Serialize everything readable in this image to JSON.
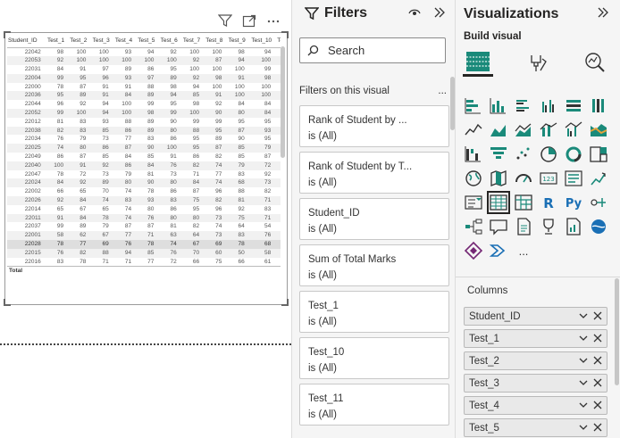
{
  "table": {
    "columns": [
      "Student_ID",
      "Test_1",
      "Test_2",
      "Test_3",
      "Test_4",
      "Test_5",
      "Test_6",
      "Test_7",
      "Test_8",
      "Test_9",
      "Test_10",
      "Te"
    ],
    "rows": [
      [
        "22042",
        "98",
        "100",
        "100",
        "93",
        "94",
        "92",
        "100",
        "100",
        "98",
        "94"
      ],
      [
        "22053",
        "92",
        "100",
        "100",
        "100",
        "100",
        "100",
        "92",
        "87",
        "94",
        "100"
      ],
      [
        "22031",
        "84",
        "91",
        "97",
        "89",
        "86",
        "95",
        "100",
        "100",
        "100",
        "99"
      ],
      [
        "22004",
        "99",
        "95",
        "96",
        "93",
        "97",
        "89",
        "92",
        "98",
        "91",
        "98"
      ],
      [
        "22000",
        "78",
        "87",
        "91",
        "91",
        "88",
        "98",
        "94",
        "100",
        "100",
        "100"
      ],
      [
        "22036",
        "95",
        "89",
        "91",
        "84",
        "89",
        "94",
        "85",
        "91",
        "100",
        "100"
      ],
      [
        "22044",
        "96",
        "92",
        "94",
        "100",
        "99",
        "95",
        "98",
        "92",
        "84",
        "84"
      ],
      [
        "22052",
        "99",
        "100",
        "94",
        "100",
        "98",
        "99",
        "100",
        "90",
        "80",
        "84"
      ],
      [
        "22012",
        "81",
        "83",
        "93",
        "88",
        "89",
        "90",
        "99",
        "99",
        "95",
        "95"
      ],
      [
        "22038",
        "82",
        "83",
        "85",
        "86",
        "89",
        "80",
        "88",
        "95",
        "87",
        "93"
      ],
      [
        "22034",
        "76",
        "79",
        "73",
        "77",
        "83",
        "86",
        "95",
        "89",
        "90",
        "95"
      ],
      [
        "22025",
        "74",
        "80",
        "86",
        "87",
        "90",
        "100",
        "95",
        "87",
        "85",
        "79"
      ],
      [
        "22049",
        "86",
        "87",
        "85",
        "84",
        "85",
        "91",
        "86",
        "82",
        "85",
        "87"
      ],
      [
        "22040",
        "100",
        "91",
        "92",
        "86",
        "84",
        "76",
        "82",
        "74",
        "79",
        "72"
      ],
      [
        "22047",
        "78",
        "72",
        "73",
        "79",
        "81",
        "73",
        "71",
        "77",
        "83",
        "92"
      ],
      [
        "22024",
        "84",
        "92",
        "89",
        "80",
        "90",
        "80",
        "84",
        "74",
        "68",
        "73"
      ],
      [
        "22002",
        "66",
        "65",
        "70",
        "74",
        "78",
        "86",
        "87",
        "96",
        "88",
        "82"
      ],
      [
        "22026",
        "92",
        "84",
        "74",
        "83",
        "93",
        "83",
        "75",
        "82",
        "81",
        "71"
      ],
      [
        "22014",
        "65",
        "67",
        "65",
        "74",
        "80",
        "86",
        "95",
        "96",
        "92",
        "83"
      ],
      [
        "22011",
        "91",
        "84",
        "78",
        "74",
        "76",
        "80",
        "80",
        "73",
        "75",
        "71"
      ],
      [
        "22037",
        "99",
        "89",
        "79",
        "87",
        "87",
        "81",
        "82",
        "74",
        "64",
        "54"
      ],
      [
        "22001",
        "58",
        "62",
        "67",
        "77",
        "71",
        "63",
        "64",
        "73",
        "83",
        "76"
      ],
      [
        "22028",
        "78",
        "77",
        "69",
        "76",
        "78",
        "74",
        "67",
        "69",
        "78",
        "68"
      ],
      [
        "22015",
        "76",
        "82",
        "88",
        "94",
        "85",
        "76",
        "70",
        "60",
        "50",
        "58"
      ],
      [
        "22016",
        "83",
        "78",
        "71",
        "71",
        "77",
        "72",
        "66",
        "75",
        "66",
        "61"
      ]
    ],
    "selected_row": 22,
    "total_label": "Total"
  },
  "filters": {
    "title": "Filters",
    "search_placeholder": "Search",
    "section_label": "Filters on this visual",
    "more": "...",
    "cards": [
      {
        "name": "Rank of Student by ...",
        "value": "is (All)"
      },
      {
        "name": "Rank of Student by T...",
        "value": "is (All)"
      },
      {
        "name": "Student_ID",
        "value": "is (All)"
      },
      {
        "name": "Sum of Total Marks",
        "value": "is (All)"
      },
      {
        "name": "Test_1",
        "value": "is (All)"
      },
      {
        "name": "Test_10",
        "value": "is (All)"
      },
      {
        "name": "Test_11",
        "value": "is (All)"
      }
    ]
  },
  "visualizations": {
    "title": "Visualizations",
    "build_label": "Build visual",
    "more": "...",
    "columns_label": "Columns",
    "fields": [
      "Student_ID",
      "Test_1",
      "Test_2",
      "Test_3",
      "Test_4",
      "Test_5"
    ]
  },
  "colors": {
    "accent_teal": "#1a8a7a",
    "accent_blue": "#118dff",
    "border": "#c8c8c8"
  }
}
